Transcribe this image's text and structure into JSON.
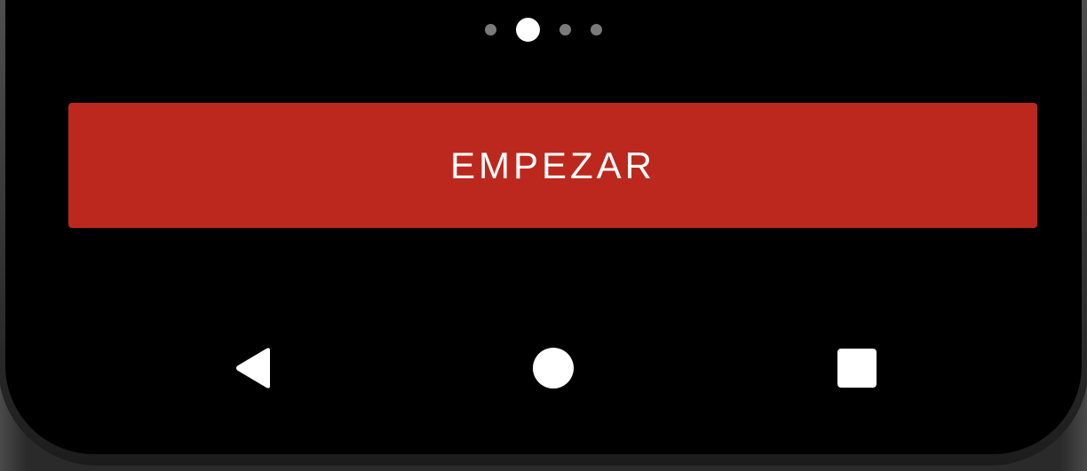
{
  "pager": {
    "count": 4,
    "active_index": 1
  },
  "cta": {
    "label": "EMPEZAR",
    "color": "#BC281D"
  },
  "nav": {
    "back_icon": "back-triangle-icon",
    "home_icon": "home-circle-icon",
    "recents_icon": "recents-square-icon",
    "icon_color": "#FFFFFF"
  }
}
